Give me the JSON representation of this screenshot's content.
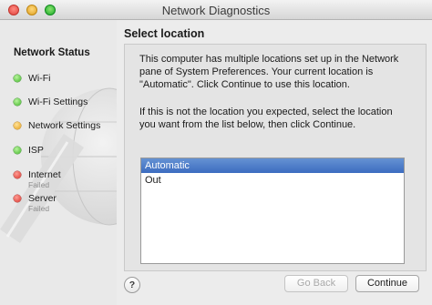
{
  "window": {
    "title": "Network Diagnostics"
  },
  "sidebar": {
    "heading": "Network Status",
    "items": [
      {
        "label": "Wi-Fi",
        "status": "green",
        "sublabel": ""
      },
      {
        "label": "Wi-Fi Settings",
        "status": "green",
        "sublabel": ""
      },
      {
        "label": "Network Settings",
        "status": "yellow",
        "sublabel": ""
      },
      {
        "label": "ISP",
        "status": "green",
        "sublabel": ""
      },
      {
        "label": "Internet",
        "status": "red",
        "sublabel": "Failed"
      },
      {
        "label": "Server",
        "status": "red",
        "sublabel": "Failed"
      }
    ]
  },
  "main": {
    "title": "Select location",
    "paragraph1": "This computer has multiple locations set up in the Network pane of System Preferences. Your current location is \"Automatic\". Click Continue to use this location.",
    "paragraph2": "If this is not the location you expected, select the location you want from the list below, then click Continue.",
    "locations": [
      {
        "label": "Automatic",
        "selected": true
      },
      {
        "label": "Out",
        "selected": false
      }
    ]
  },
  "footer": {
    "help_label": "?",
    "back_label": "Go Back",
    "back_enabled": false,
    "continue_label": "Continue"
  },
  "colors": {
    "selection": "#3c6cc0",
    "status_green": "#3fb427",
    "status_yellow": "#e49d16",
    "status_red": "#d8322b"
  }
}
